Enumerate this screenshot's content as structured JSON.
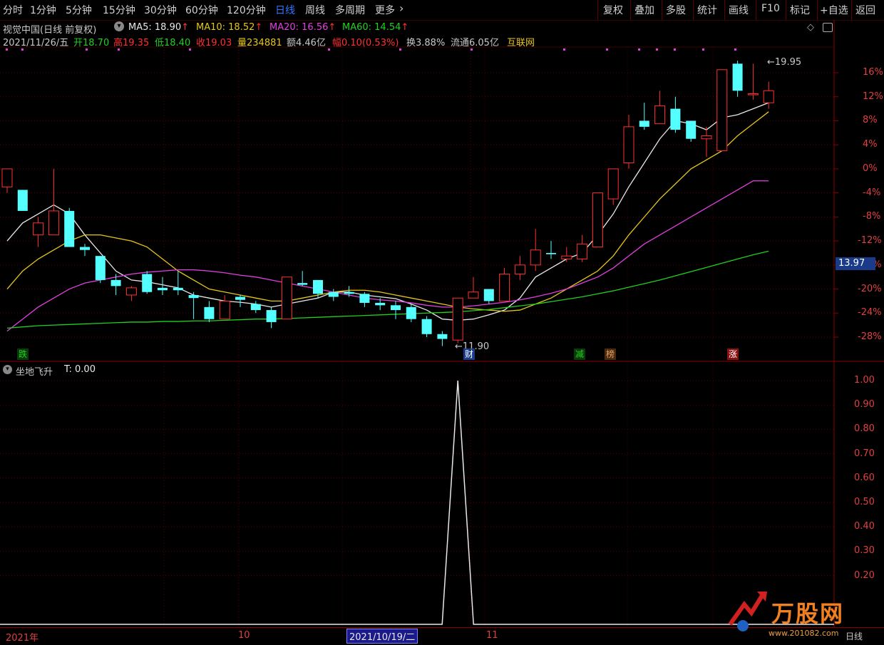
{
  "toolbar": {
    "left": [
      "分时",
      "1分钟",
      "5分钟",
      "15分钟",
      "30分钟",
      "60分钟",
      "120分钟",
      "日线",
      "周线",
      "多周期",
      "更多"
    ],
    "more_arrow": "›",
    "right": [
      "复权",
      "叠加",
      "多股",
      "统计",
      "画线",
      "F10",
      "标记",
      "+自选",
      "返回"
    ]
  },
  "header": {
    "stock": "视觉中国(日线 前复权)",
    "ma5": "MA5: 18.90",
    "ma10": "MA10: 18.52",
    "ma20": "MA20: 16.56",
    "ma60": "MA60: 14.54",
    "up_arrow": "↑",
    "date": "2021/11/26/五",
    "open": "开18.70",
    "high": "高19.35",
    "low": "低18.40",
    "close": "收19.03",
    "volume": "量234881",
    "amount": "额4.46亿",
    "change": "幅0.10(0.53%)",
    "turnover": "换3.88%",
    "float": "流通6.05亿",
    "sector": "互联网"
  },
  "price_axis": [
    "16%",
    "12%",
    "8%",
    "4%",
    "0%",
    "-4%",
    "-8%",
    "-12%",
    "-16%",
    "-20%",
    "-24%",
    "-28%"
  ],
  "current_price": "13.97",
  "annotations": {
    "high_label": "19.95",
    "low_label": "11.90",
    "tag_die": "跌",
    "tag_cai": "财",
    "tag_jian": "减",
    "tag_bang": "榜",
    "tag_zhang": "涨"
  },
  "indicator": {
    "title": "坐地飞升",
    "value": "T: 0.00",
    "axis": [
      "1.00",
      "0.90",
      "0.80",
      "0.70",
      "0.60",
      "0.50",
      "0.40",
      "0.30",
      "0.20"
    ]
  },
  "timeline": {
    "start": "2021年",
    "m10": "10",
    "cursor_date": "2021/10/19/二",
    "m11": "11"
  },
  "watermark": {
    "brand": "万股网",
    "url": "www.201082.com",
    "corner": "日线"
  },
  "chart_data": {
    "type": "candlestick",
    "price_axis_percent": [
      16,
      12,
      8,
      4,
      0,
      -4,
      -8,
      -12,
      -16,
      -20,
      -24,
      -28
    ],
    "ma_values_latest": {
      "MA5": 18.9,
      "MA10": 18.52,
      "MA20": 16.56,
      "MA60": 14.54
    },
    "high": 19.95,
    "low": 11.9,
    "candles": [
      {
        "o": -3,
        "c": 0,
        "h": 0,
        "l": -4
      },
      {
        "o": -3.5,
        "c": -7,
        "h": -3.5,
        "l": -7
      },
      {
        "o": -11,
        "c": -9,
        "h": -8,
        "l": -13
      },
      {
        "o": -11,
        "c": -7,
        "h": 0,
        "l": -11
      },
      {
        "o": -7,
        "c": -13,
        "h": -6.5,
        "l": -13
      },
      {
        "o": -13,
        "c": -13.5,
        "h": -12.5,
        "l": -14.5
      },
      {
        "o": -14.5,
        "c": -18.5,
        "h": -14.5,
        "l": -19
      },
      {
        "o": -18.5,
        "c": -19.5,
        "h": -17.5,
        "l": -21
      },
      {
        "o": -21,
        "c": -19.8,
        "h": -19.5,
        "l": -22
      },
      {
        "o": -17.5,
        "c": -20.5,
        "h": -17,
        "l": -20.8
      },
      {
        "o": -19.8,
        "c": -20.2,
        "h": -18,
        "l": -21
      },
      {
        "o": -19.8,
        "c": -20.2,
        "h": -17,
        "l": -21
      },
      {
        "o": -21,
        "c": -21.5,
        "h": -20.5,
        "l": -25
      },
      {
        "o": -23,
        "c": -25,
        "h": -22,
        "l": -25.5
      },
      {
        "o": -25,
        "c": -22,
        "h": -21,
        "l": -25
      },
      {
        "o": -21.3,
        "c": -21.8,
        "h": -21,
        "l": -23
      },
      {
        "o": -22.5,
        "c": -23.5,
        "h": -22,
        "l": -24
      },
      {
        "o": -23.5,
        "c": -25.5,
        "h": -23,
        "l": -26.5
      },
      {
        "o": -25,
        "c": -18,
        "h": -18,
        "l": -25
      },
      {
        "o": -19,
        "c": -19.3,
        "h": -17,
        "l": -19.5
      },
      {
        "o": -18.5,
        "c": -20.8,
        "h": -18.5,
        "l": -21.5
      },
      {
        "o": -20.5,
        "c": -21.3,
        "h": -20,
        "l": -22
      },
      {
        "o": -20.5,
        "c": -20.8,
        "h": -19.5,
        "l": -21.3
      },
      {
        "o": -20.8,
        "c": -22.3,
        "h": -20.5,
        "l": -23
      },
      {
        "o": -22.3,
        "c": -22.7,
        "h": -21.5,
        "l": -23.5
      },
      {
        "o": -22.7,
        "c": -23.5,
        "h": -22,
        "l": -25
      },
      {
        "o": -23,
        "c": -25,
        "h": -22.5,
        "l": -25.5
      },
      {
        "o": -25,
        "c": -27.5,
        "h": -24.5,
        "l": -28
      },
      {
        "o": -27.5,
        "c": -28.3,
        "h": -27,
        "l": -29.5
      },
      {
        "o": -28.5,
        "c": -21.5,
        "h": -21.5,
        "l": -29
      },
      {
        "o": -21.5,
        "c": -20.5,
        "h": -18,
        "l": -21.5
      },
      {
        "o": -20,
        "c": -22,
        "h": -20,
        "l": -22.5
      },
      {
        "o": -22,
        "c": -17.5,
        "h": -16.5,
        "l": -22
      },
      {
        "o": -17.5,
        "c": -16,
        "h": -14.5,
        "l": -18.5
      },
      {
        "o": -16,
        "c": -13.5,
        "h": -10,
        "l": -17
      },
      {
        "o": -14,
        "c": -14.2,
        "h": -12,
        "l": -15
      },
      {
        "o": -15,
        "c": -14.5,
        "h": -13,
        "l": -15.5
      },
      {
        "o": -15,
        "c": -12.5,
        "h": -11,
        "l": -15.5
      },
      {
        "o": -13,
        "c": -4,
        "h": -4,
        "l": -13
      },
      {
        "o": -5,
        "c": 0,
        "h": 0,
        "l": -6
      },
      {
        "o": 1,
        "c": 7,
        "h": 9,
        "l": 0
      },
      {
        "o": 8,
        "c": 7,
        "h": 11,
        "l": 6.5
      },
      {
        "o": 7.5,
        "c": 10.5,
        "h": 13,
        "l": 7.5
      },
      {
        "o": 10,
        "c": 6.5,
        "h": 12,
        "l": 6
      },
      {
        "o": 8,
        "c": 5,
        "h": 8,
        "l": 4.5
      },
      {
        "o": 5,
        "c": 5.5,
        "h": 7,
        "l": 2
      },
      {
        "o": 3,
        "c": 16.5,
        "h": 16.5,
        "l": 3
      },
      {
        "o": 17.5,
        "c": 13,
        "h": 18,
        "l": 12
      },
      {
        "o": 12.5,
        "c": 12.5,
        "h": 17.5,
        "l": 11.5
      },
      {
        "o": 11,
        "c": 13,
        "h": 14.5,
        "l": 10
      }
    ],
    "ma_series": [
      {
        "name": "MA5",
        "color": "#e8e8e8",
        "values": [
          -12,
          -9,
          -7.5,
          -6,
          -7.5,
          -11,
          -14,
          -17,
          -18.5,
          -18.8,
          -19.3,
          -19.8,
          -21,
          -21.5,
          -22,
          -22.2,
          -22.5,
          -23,
          -22.5,
          -22,
          -21.5,
          -20.5,
          -20.5,
          -21,
          -21.3,
          -21.6,
          -22.5,
          -23.5,
          -25,
          -25.2,
          -25,
          -24.3,
          -23.5,
          -21.5,
          -18,
          -16.5,
          -15,
          -14,
          -11,
          -7.5,
          -3,
          1,
          5,
          8,
          7.5,
          6.5,
          8.5,
          9,
          10,
          11
        ]
      },
      {
        "name": "MA10",
        "color": "#e6c619",
        "values": [
          -20,
          -17,
          -15,
          -13.5,
          -12,
          -11,
          -11,
          -11.5,
          -12,
          -13,
          -15,
          -17,
          -18.5,
          -20,
          -20.5,
          -21,
          -21.5,
          -22,
          -22,
          -21.5,
          -21,
          -20.5,
          -20.2,
          -20.2,
          -20.5,
          -21,
          -21.5,
          -22,
          -22.5,
          -23,
          -23.3,
          -23.5,
          -23.7,
          -23.5,
          -22.5,
          -21.5,
          -20,
          -18.5,
          -17,
          -14.5,
          -11,
          -8,
          -5,
          -2.5,
          0,
          1.5,
          3,
          5.5,
          7.5,
          9.5
        ]
      },
      {
        "name": "MA20",
        "color": "#e040e0",
        "values": [
          -27,
          -25,
          -23,
          -21.5,
          -20,
          -19,
          -18.5,
          -18,
          -17.5,
          -17.2,
          -17,
          -16.8,
          -16.8,
          -17,
          -17.3,
          -17.7,
          -18,
          -18.5,
          -19,
          -19.5,
          -20,
          -20.5,
          -21,
          -21.5,
          -21.8,
          -22,
          -22.3,
          -22.7,
          -23,
          -23,
          -22.8,
          -22.5,
          -22.2,
          -21.8,
          -21.3,
          -20.7,
          -20,
          -19,
          -18,
          -16.5,
          -14.5,
          -12.5,
          -11,
          -9.5,
          -8,
          -6.5,
          -5,
          -3.5,
          -2,
          -2
        ]
      },
      {
        "name": "MA60",
        "color": "#20d020",
        "values": [
          -26.5,
          -26.3,
          -26.1,
          -26,
          -25.9,
          -25.8,
          -25.7,
          -25.6,
          -25.5,
          -25.5,
          -25.4,
          -25.4,
          -25.3,
          -25.3,
          -25.2,
          -25.1,
          -25,
          -25,
          -24.9,
          -24.8,
          -24.7,
          -24.6,
          -24.5,
          -24.4,
          -24.3,
          -24.2,
          -24.1,
          -24,
          -23.9,
          -23.8,
          -23.6,
          -23.4,
          -23.1,
          -22.8,
          -22.5,
          -22.1,
          -21.7,
          -21.3,
          -20.8,
          -20.3,
          -19.7,
          -19.1,
          -18.5,
          -17.8,
          -17.1,
          -16.4,
          -15.7,
          -15,
          -14.3,
          -13.7
        ]
      }
    ],
    "indicator_series": {
      "name": "坐地飞升",
      "spike_index": 29,
      "spike_value": 1.0,
      "range": [
        0,
        1.0
      ]
    }
  }
}
